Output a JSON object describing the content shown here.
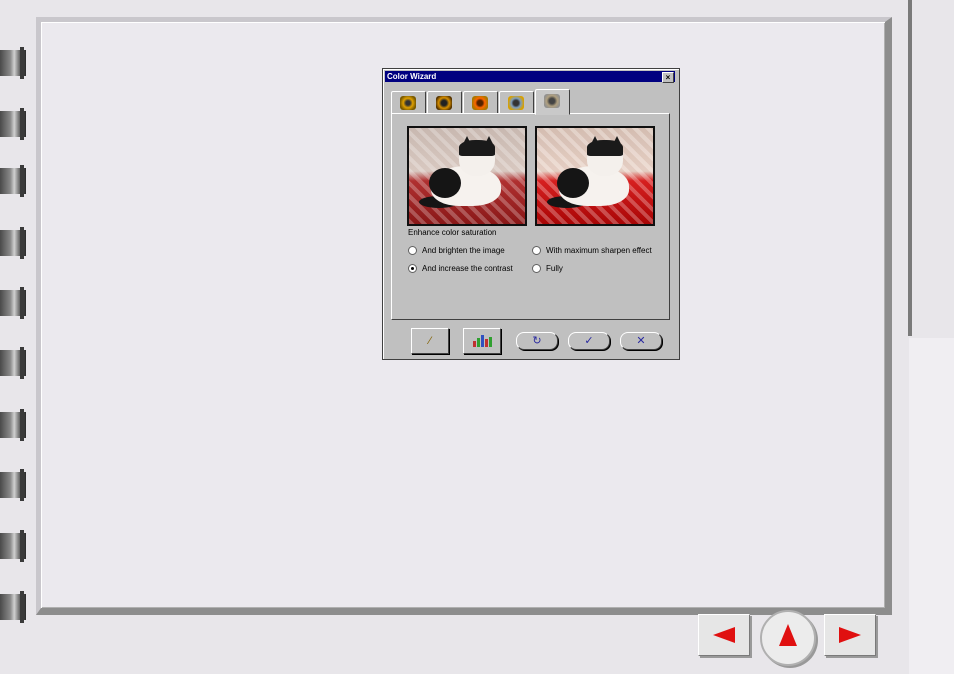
{
  "dialog": {
    "title": "Color Wizard",
    "close_glyph": "×",
    "tabs": [
      {
        "icon": "sunflower-filter-icon-1",
        "active": false
      },
      {
        "icon": "sunflower-filter-icon-2",
        "active": false
      },
      {
        "icon": "sunflower-filter-icon-3",
        "active": false
      },
      {
        "icon": "sunflower-filter-icon-4",
        "active": false
      },
      {
        "icon": "sunflower-filter-icon-5",
        "active": true
      }
    ],
    "section_label": "Enhance color saturation",
    "options": {
      "brighten": {
        "label": "And brighten the image",
        "checked": false
      },
      "max_sharpen": {
        "label": "With maximum sharpen effect",
        "checked": false
      },
      "contrast": {
        "label": "And increase the contrast",
        "checked": true
      },
      "fully": {
        "label": "Fully",
        "checked": false
      }
    },
    "buttons": {
      "wizard_icon": "magic-wand-icon",
      "histogram_icon": "histogram-icon",
      "reset_glyph": "↻",
      "ok_glyph": "✓",
      "cancel_glyph": "✕"
    }
  },
  "nav": {
    "prev_icon": "arrow-left-icon",
    "up_icon": "arrow-up-icon",
    "next_icon": "arrow-right-icon",
    "arrow_color": "#e01010"
  }
}
